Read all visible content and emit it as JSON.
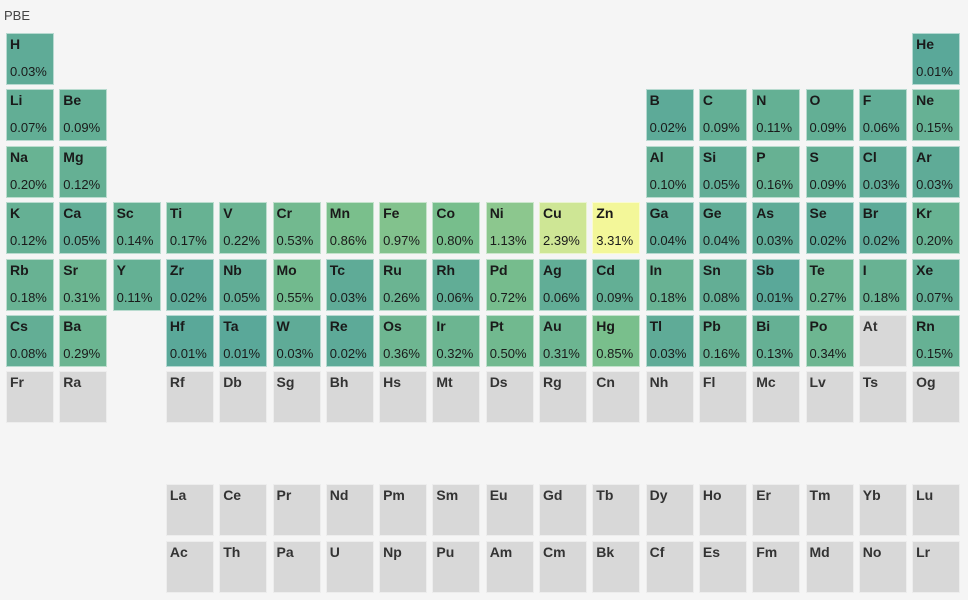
{
  "title": "PBE",
  "chart_data": {
    "type": "heatmap",
    "title": "PBE",
    "colors": {
      "low": "#5aa899",
      "high": "#f3f799",
      "empty": "#d8d8d8"
    },
    "elements": [
      {
        "symbol": "H",
        "row": 1,
        "col": 1,
        "value": 0.03,
        "label": "0.03%"
      },
      {
        "symbol": "He",
        "row": 1,
        "col": 18,
        "value": 0.01,
        "label": "0.01%"
      },
      {
        "symbol": "Li",
        "row": 2,
        "col": 1,
        "value": 0.07,
        "label": "0.07%"
      },
      {
        "symbol": "Be",
        "row": 2,
        "col": 2,
        "value": 0.09,
        "label": "0.09%"
      },
      {
        "symbol": "B",
        "row": 2,
        "col": 13,
        "value": 0.02,
        "label": "0.02%"
      },
      {
        "symbol": "C",
        "row": 2,
        "col": 14,
        "value": 0.09,
        "label": "0.09%"
      },
      {
        "symbol": "N",
        "row": 2,
        "col": 15,
        "value": 0.11,
        "label": "0.11%"
      },
      {
        "symbol": "O",
        "row": 2,
        "col": 16,
        "value": 0.09,
        "label": "0.09%"
      },
      {
        "symbol": "F",
        "row": 2,
        "col": 17,
        "value": 0.06,
        "label": "0.06%"
      },
      {
        "symbol": "Ne",
        "row": 2,
        "col": 18,
        "value": 0.15,
        "label": "0.15%"
      },
      {
        "symbol": "Na",
        "row": 3,
        "col": 1,
        "value": 0.2,
        "label": "0.20%"
      },
      {
        "symbol": "Mg",
        "row": 3,
        "col": 2,
        "value": 0.12,
        "label": "0.12%"
      },
      {
        "symbol": "Al",
        "row": 3,
        "col": 13,
        "value": 0.1,
        "label": "0.10%"
      },
      {
        "symbol": "Si",
        "row": 3,
        "col": 14,
        "value": 0.05,
        "label": "0.05%"
      },
      {
        "symbol": "P",
        "row": 3,
        "col": 15,
        "value": 0.16,
        "label": "0.16%"
      },
      {
        "symbol": "S",
        "row": 3,
        "col": 16,
        "value": 0.09,
        "label": "0.09%"
      },
      {
        "symbol": "Cl",
        "row": 3,
        "col": 17,
        "value": 0.03,
        "label": "0.03%"
      },
      {
        "symbol": "Ar",
        "row": 3,
        "col": 18,
        "value": 0.03,
        "label": "0.03%"
      },
      {
        "symbol": "K",
        "row": 4,
        "col": 1,
        "value": 0.12,
        "label": "0.12%"
      },
      {
        "symbol": "Ca",
        "row": 4,
        "col": 2,
        "value": 0.05,
        "label": "0.05%"
      },
      {
        "symbol": "Sc",
        "row": 4,
        "col": 3,
        "value": 0.14,
        "label": "0.14%"
      },
      {
        "symbol": "Ti",
        "row": 4,
        "col": 4,
        "value": 0.17,
        "label": "0.17%"
      },
      {
        "symbol": "V",
        "row": 4,
        "col": 5,
        "value": 0.22,
        "label": "0.22%"
      },
      {
        "symbol": "Cr",
        "row": 4,
        "col": 6,
        "value": 0.53,
        "label": "0.53%"
      },
      {
        "symbol": "Mn",
        "row": 4,
        "col": 7,
        "value": 0.86,
        "label": "0.86%"
      },
      {
        "symbol": "Fe",
        "row": 4,
        "col": 8,
        "value": 0.97,
        "label": "0.97%"
      },
      {
        "symbol": "Co",
        "row": 4,
        "col": 9,
        "value": 0.8,
        "label": "0.80%"
      },
      {
        "symbol": "Ni",
        "row": 4,
        "col": 10,
        "value": 1.13,
        "label": "1.13%"
      },
      {
        "symbol": "Cu",
        "row": 4,
        "col": 11,
        "value": 2.39,
        "label": "2.39%"
      },
      {
        "symbol": "Zn",
        "row": 4,
        "col": 12,
        "value": 3.31,
        "label": "3.31%"
      },
      {
        "symbol": "Ga",
        "row": 4,
        "col": 13,
        "value": 0.04,
        "label": "0.04%"
      },
      {
        "symbol": "Ge",
        "row": 4,
        "col": 14,
        "value": 0.04,
        "label": "0.04%"
      },
      {
        "symbol": "As",
        "row": 4,
        "col": 15,
        "value": 0.03,
        "label": "0.03%"
      },
      {
        "symbol": "Se",
        "row": 4,
        "col": 16,
        "value": 0.02,
        "label": "0.02%"
      },
      {
        "symbol": "Br",
        "row": 4,
        "col": 17,
        "value": 0.02,
        "label": "0.02%"
      },
      {
        "symbol": "Kr",
        "row": 4,
        "col": 18,
        "value": 0.2,
        "label": "0.20%"
      },
      {
        "symbol": "Rb",
        "row": 5,
        "col": 1,
        "value": 0.18,
        "label": "0.18%"
      },
      {
        "symbol": "Sr",
        "row": 5,
        "col": 2,
        "value": 0.31,
        "label": "0.31%"
      },
      {
        "symbol": "Y",
        "row": 5,
        "col": 3,
        "value": 0.11,
        "label": "0.11%"
      },
      {
        "symbol": "Zr",
        "row": 5,
        "col": 4,
        "value": 0.02,
        "label": "0.02%"
      },
      {
        "symbol": "Nb",
        "row": 5,
        "col": 5,
        "value": 0.05,
        "label": "0.05%"
      },
      {
        "symbol": "Mo",
        "row": 5,
        "col": 6,
        "value": 0.55,
        "label": "0.55%"
      },
      {
        "symbol": "Tc",
        "row": 5,
        "col": 7,
        "value": 0.03,
        "label": "0.03%"
      },
      {
        "symbol": "Ru",
        "row": 5,
        "col": 8,
        "value": 0.26,
        "label": "0.26%"
      },
      {
        "symbol": "Rh",
        "row": 5,
        "col": 9,
        "value": 0.06,
        "label": "0.06%"
      },
      {
        "symbol": "Pd",
        "row": 5,
        "col": 10,
        "value": 0.72,
        "label": "0.72%"
      },
      {
        "symbol": "Ag",
        "row": 5,
        "col": 11,
        "value": 0.06,
        "label": "0.06%"
      },
      {
        "symbol": "Cd",
        "row": 5,
        "col": 12,
        "value": 0.09,
        "label": "0.09%"
      },
      {
        "symbol": "In",
        "row": 5,
        "col": 13,
        "value": 0.18,
        "label": "0.18%"
      },
      {
        "symbol": "Sn",
        "row": 5,
        "col": 14,
        "value": 0.08,
        "label": "0.08%"
      },
      {
        "symbol": "Sb",
        "row": 5,
        "col": 15,
        "value": 0.01,
        "label": "0.01%"
      },
      {
        "symbol": "Te",
        "row": 5,
        "col": 16,
        "value": 0.27,
        "label": "0.27%"
      },
      {
        "symbol": "I",
        "row": 5,
        "col": 17,
        "value": 0.18,
        "label": "0.18%"
      },
      {
        "symbol": "Xe",
        "row": 5,
        "col": 18,
        "value": 0.07,
        "label": "0.07%"
      },
      {
        "symbol": "Cs",
        "row": 6,
        "col": 1,
        "value": 0.08,
        "label": "0.08%"
      },
      {
        "symbol": "Ba",
        "row": 6,
        "col": 2,
        "value": 0.29,
        "label": "0.29%"
      },
      {
        "symbol": "Hf",
        "row": 6,
        "col": 4,
        "value": 0.01,
        "label": "0.01%"
      },
      {
        "symbol": "Ta",
        "row": 6,
        "col": 5,
        "value": 0.01,
        "label": "0.01%"
      },
      {
        "symbol": "W",
        "row": 6,
        "col": 6,
        "value": 0.03,
        "label": "0.03%"
      },
      {
        "symbol": "Re",
        "row": 6,
        "col": 7,
        "value": 0.02,
        "label": "0.02%"
      },
      {
        "symbol": "Os",
        "row": 6,
        "col": 8,
        "value": 0.36,
        "label": "0.36%"
      },
      {
        "symbol": "Ir",
        "row": 6,
        "col": 9,
        "value": 0.32,
        "label": "0.32%"
      },
      {
        "symbol": "Pt",
        "row": 6,
        "col": 10,
        "value": 0.5,
        "label": "0.50%"
      },
      {
        "symbol": "Au",
        "row": 6,
        "col": 11,
        "value": 0.31,
        "label": "0.31%"
      },
      {
        "symbol": "Hg",
        "row": 6,
        "col": 12,
        "value": 0.85,
        "label": "0.85%"
      },
      {
        "symbol": "Tl",
        "row": 6,
        "col": 13,
        "value": 0.03,
        "label": "0.03%"
      },
      {
        "symbol": "Pb",
        "row": 6,
        "col": 14,
        "value": 0.16,
        "label": "0.16%"
      },
      {
        "symbol": "Bi",
        "row": 6,
        "col": 15,
        "value": 0.13,
        "label": "0.13%"
      },
      {
        "symbol": "Po",
        "row": 6,
        "col": 16,
        "value": 0.34,
        "label": "0.34%"
      },
      {
        "symbol": "At",
        "row": 6,
        "col": 17,
        "value": null,
        "label": ""
      },
      {
        "symbol": "Rn",
        "row": 6,
        "col": 18,
        "value": 0.15,
        "label": "0.15%"
      },
      {
        "symbol": "Fr",
        "row": 7,
        "col": 1,
        "value": null,
        "label": ""
      },
      {
        "symbol": "Ra",
        "row": 7,
        "col": 2,
        "value": null,
        "label": ""
      },
      {
        "symbol": "Rf",
        "row": 7,
        "col": 4,
        "value": null,
        "label": ""
      },
      {
        "symbol": "Db",
        "row": 7,
        "col": 5,
        "value": null,
        "label": ""
      },
      {
        "symbol": "Sg",
        "row": 7,
        "col": 6,
        "value": null,
        "label": ""
      },
      {
        "symbol": "Bh",
        "row": 7,
        "col": 7,
        "value": null,
        "label": ""
      },
      {
        "symbol": "Hs",
        "row": 7,
        "col": 8,
        "value": null,
        "label": ""
      },
      {
        "symbol": "Mt",
        "row": 7,
        "col": 9,
        "value": null,
        "label": ""
      },
      {
        "symbol": "Ds",
        "row": 7,
        "col": 10,
        "value": null,
        "label": ""
      },
      {
        "symbol": "Rg",
        "row": 7,
        "col": 11,
        "value": null,
        "label": ""
      },
      {
        "symbol": "Cn",
        "row": 7,
        "col": 12,
        "value": null,
        "label": ""
      },
      {
        "symbol": "Nh",
        "row": 7,
        "col": 13,
        "value": null,
        "label": ""
      },
      {
        "symbol": "Fl",
        "row": 7,
        "col": 14,
        "value": null,
        "label": ""
      },
      {
        "symbol": "Mc",
        "row": 7,
        "col": 15,
        "value": null,
        "label": ""
      },
      {
        "symbol": "Lv",
        "row": 7,
        "col": 16,
        "value": null,
        "label": ""
      },
      {
        "symbol": "Ts",
        "row": 7,
        "col": 17,
        "value": null,
        "label": ""
      },
      {
        "symbol": "Og",
        "row": 7,
        "col": 18,
        "value": null,
        "label": ""
      },
      {
        "symbol": "La",
        "row": 9,
        "col": 4,
        "value": null,
        "label": ""
      },
      {
        "symbol": "Ce",
        "row": 9,
        "col": 5,
        "value": null,
        "label": ""
      },
      {
        "symbol": "Pr",
        "row": 9,
        "col": 6,
        "value": null,
        "label": ""
      },
      {
        "symbol": "Nd",
        "row": 9,
        "col": 7,
        "value": null,
        "label": ""
      },
      {
        "symbol": "Pm",
        "row": 9,
        "col": 8,
        "value": null,
        "label": ""
      },
      {
        "symbol": "Sm",
        "row": 9,
        "col": 9,
        "value": null,
        "label": ""
      },
      {
        "symbol": "Eu",
        "row": 9,
        "col": 10,
        "value": null,
        "label": ""
      },
      {
        "symbol": "Gd",
        "row": 9,
        "col": 11,
        "value": null,
        "label": ""
      },
      {
        "symbol": "Tb",
        "row": 9,
        "col": 12,
        "value": null,
        "label": ""
      },
      {
        "symbol": "Dy",
        "row": 9,
        "col": 13,
        "value": null,
        "label": ""
      },
      {
        "symbol": "Ho",
        "row": 9,
        "col": 14,
        "value": null,
        "label": ""
      },
      {
        "symbol": "Er",
        "row": 9,
        "col": 15,
        "value": null,
        "label": ""
      },
      {
        "symbol": "Tm",
        "row": 9,
        "col": 16,
        "value": null,
        "label": ""
      },
      {
        "symbol": "Yb",
        "row": 9,
        "col": 17,
        "value": null,
        "label": ""
      },
      {
        "symbol": "Lu",
        "row": 9,
        "col": 18,
        "value": null,
        "label": ""
      },
      {
        "symbol": "Ac",
        "row": 10,
        "col": 4,
        "value": null,
        "label": ""
      },
      {
        "symbol": "Th",
        "row": 10,
        "col": 5,
        "value": null,
        "label": ""
      },
      {
        "symbol": "Pa",
        "row": 10,
        "col": 6,
        "value": null,
        "label": ""
      },
      {
        "symbol": "U",
        "row": 10,
        "col": 7,
        "value": null,
        "label": ""
      },
      {
        "symbol": "Np",
        "row": 10,
        "col": 8,
        "value": null,
        "label": ""
      },
      {
        "symbol": "Pu",
        "row": 10,
        "col": 9,
        "value": null,
        "label": ""
      },
      {
        "symbol": "Am",
        "row": 10,
        "col": 10,
        "value": null,
        "label": ""
      },
      {
        "symbol": "Cm",
        "row": 10,
        "col": 11,
        "value": null,
        "label": ""
      },
      {
        "symbol": "Bk",
        "row": 10,
        "col": 12,
        "value": null,
        "label": ""
      },
      {
        "symbol": "Cf",
        "row": 10,
        "col": 13,
        "value": null,
        "label": ""
      },
      {
        "symbol": "Es",
        "row": 10,
        "col": 14,
        "value": null,
        "label": ""
      },
      {
        "symbol": "Fm",
        "row": 10,
        "col": 15,
        "value": null,
        "label": ""
      },
      {
        "symbol": "Md",
        "row": 10,
        "col": 16,
        "value": null,
        "label": ""
      },
      {
        "symbol": "No",
        "row": 10,
        "col": 17,
        "value": null,
        "label": ""
      },
      {
        "symbol": "Lr",
        "row": 10,
        "col": 18,
        "value": null,
        "label": ""
      }
    ]
  }
}
